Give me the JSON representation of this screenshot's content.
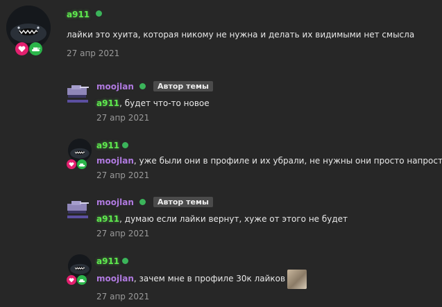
{
  "posts": [
    {
      "author": "a911",
      "text": "лайки это хуита, которая никому не нужна и делать их видимыми нет смысла",
      "date": "27 апр 2021"
    },
    {
      "author": "moojlan",
      "author_tag": "Автор темы",
      "mention": "a911",
      "text": ", будет что-то новое",
      "date": "27 апр 2021"
    },
    {
      "author": "a911",
      "mention": "moojlan",
      "text": ", уже были они в профиле и их убрали, не нужны они просто напросто",
      "date": "27 апр 2021"
    },
    {
      "author": "moojlan",
      "author_tag": "Автор темы",
      "mention": "a911",
      "text": ", думаю если лайки вернут, хуже от этого не будет",
      "date": "27 апр 2021"
    },
    {
      "author": "a911",
      "mention": "moojlan",
      "text": ", зачем мне в профиле 30к лайков",
      "date": "27 апр 2021"
    }
  ],
  "icons": {
    "avatar_a911": "shark-avatar",
    "avatar_moojlan": "tank-avatar",
    "badge_heart": "heart-icon",
    "badge_tank": "tank-icon",
    "online": "online-dot"
  },
  "colors": {
    "background": "#272727",
    "green_name": "#5ee84e",
    "purple_name": "#b07ae0",
    "online": "#3bb45a",
    "heart_badge": "#e3206f",
    "tank_badge": "#2bb54a",
    "author_tag_bg": "#4b4b4b"
  }
}
